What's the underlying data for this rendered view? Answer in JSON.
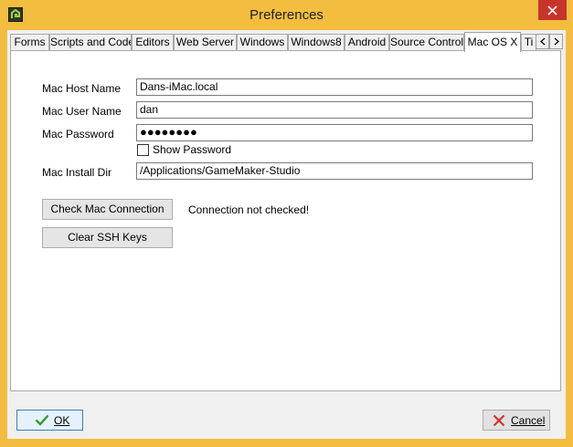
{
  "window": {
    "title": "Preferences"
  },
  "tabs": [
    {
      "label": "Forms",
      "active": false
    },
    {
      "label": "Scripts and Code",
      "active": false
    },
    {
      "label": "Editors",
      "active": false
    },
    {
      "label": "Web Server",
      "active": false
    },
    {
      "label": "Windows",
      "active": false
    },
    {
      "label": "Windows8",
      "active": false
    },
    {
      "label": "Android",
      "active": false
    },
    {
      "label": "Source Control",
      "active": false
    },
    {
      "label": "Mac OS X",
      "active": true
    },
    {
      "label": "Ti",
      "active": false
    }
  ],
  "mac": {
    "host_label": "Mac Host Name",
    "host_value": "Dans-iMac.local",
    "user_label": "Mac User Name",
    "user_value": "dan",
    "password_label": "Mac Password",
    "password_value": "●●●●●●●●",
    "show_password_label": "Show Password",
    "show_password_checked": false,
    "install_dir_label": "Mac Install Dir",
    "install_dir_value": "/Applications/GameMaker-Studio",
    "check_connection_label": "Check Mac Connection",
    "connection_status": "Connection not checked!",
    "clear_ssh_label": "Clear SSH Keys"
  },
  "footer": {
    "ok_label": "OK",
    "cancel_label": "Cancel"
  },
  "colors": {
    "frame": "#f3bd40",
    "close": "#c7342b",
    "ok_check": "#2e9a2e",
    "cancel_x": "#d0342a"
  },
  "icons": {
    "app": "gamemaker-logo-icon",
    "close": "close-icon",
    "tab_left": "chevron-left-icon",
    "tab_right": "chevron-right-icon",
    "ok": "checkmark-icon",
    "cancel": "x-icon"
  }
}
